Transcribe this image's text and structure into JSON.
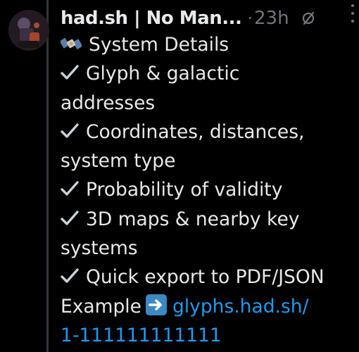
{
  "tweet": {
    "display_name": "had.sh | No Man...",
    "separator": "·",
    "time": "23h",
    "icons": {
      "avatar": "avatar-image",
      "edit": "edit-indicator-icon",
      "more": "more-options-icon"
    },
    "body": {
      "heading_icon": "satellite-icon",
      "heading": "System Details",
      "check_icon": "check-mark-icon",
      "items": [
        "Glyph & galactic",
        "addresses",
        "Coordinates, distances,",
        "system type",
        "Probability of validity",
        "3D maps & nearby key",
        "systems",
        "Quick export to PDF/JSON"
      ],
      "example_label": "Example",
      "example_icon": "right-arrow-icon",
      "link_part1": "glyphs.had.sh/",
      "link_part2": "1-111111111111"
    },
    "colors": {
      "background": "#000000",
      "text": "#e7e9ea",
      "muted": "#71767b",
      "link": "#1d9bf0",
      "thread_line": "#333639"
    }
  }
}
